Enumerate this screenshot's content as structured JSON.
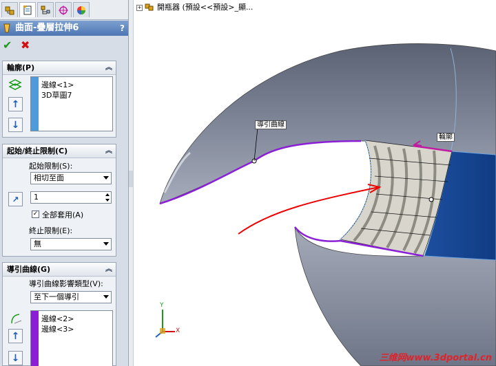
{
  "property_manager": {
    "tabs": [
      "feature-manager-icon",
      "property-manager-icon",
      "configuration-manager-icon",
      "dimxpert-icon",
      "display-manager-icon"
    ],
    "title": "曲面-疊層拉伸6",
    "help": "?",
    "ok_label": "✔",
    "cancel_label": "✖"
  },
  "profiles": {
    "header": "輪廓(P)",
    "items": [
      "邊線<1>",
      "3D草圖7"
    ],
    "color": "#4f9ad8"
  },
  "start_end": {
    "header": "起始/終止限制(C)",
    "start_label": "起始限制(S):",
    "start_value": "相切至面",
    "spin_value": "1",
    "apply_all_label": "全部套用(A)",
    "apply_all_checked": "✓",
    "end_label": "終止限制(E):",
    "end_value": "無"
  },
  "guides": {
    "header": "導引曲線(G)",
    "influence_label": "導引曲線影響類型(V):",
    "influence_value": "至下一個導引",
    "items": [
      "邊線<2>",
      "邊線<3>"
    ],
    "color": "#8a1fd6"
  },
  "viewport": {
    "tree_text": "開瓶器 (預設<<預設>_顯...",
    "callout_guide": "導引曲線",
    "callout_profile": "輪廓",
    "axis_x": "X",
    "axis_y": "Y",
    "watermark": "三维网www.3dportal.cn"
  }
}
